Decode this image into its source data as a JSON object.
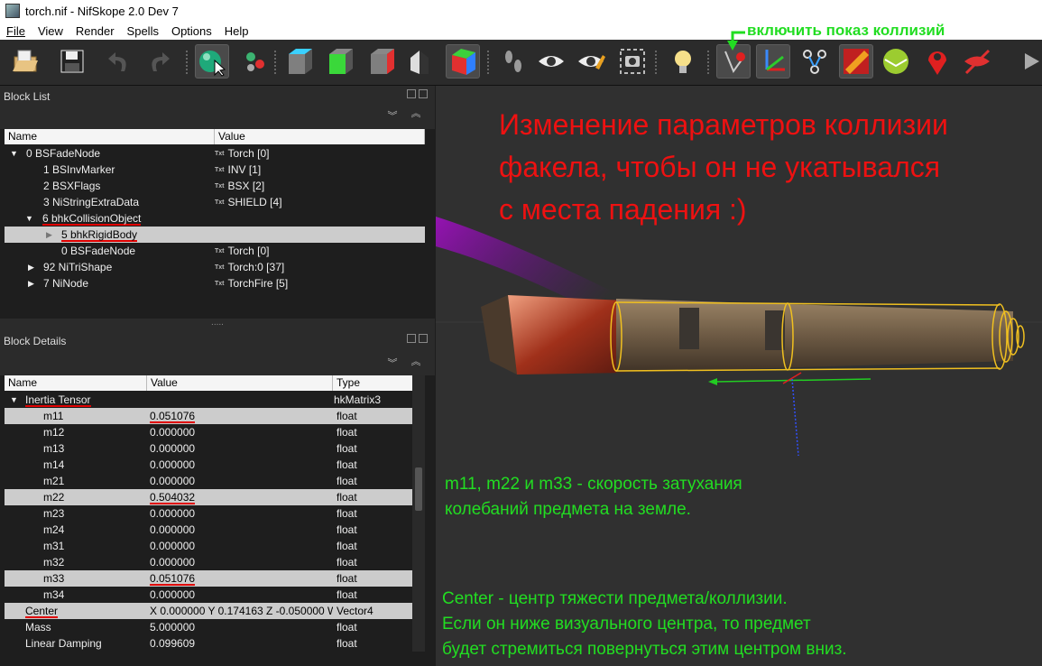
{
  "window": {
    "title": "torch.nif - NifSkope 2.0 Dev 7"
  },
  "menu": [
    "File",
    "View",
    "Render",
    "Spells",
    "Options",
    "Help"
  ],
  "toolbar_icons": [
    "open-icon",
    "save-icon",
    "undo-icon",
    "redo-icon",
    "select-icon",
    "transform-icon",
    "view-top-icon",
    "view-front-icon",
    "view-side-icon",
    "view-user-icon",
    "view-perspective-icon",
    "walk-icon",
    "eye-icon",
    "eye-dropper-icon",
    "screenshot-icon",
    "light-icon",
    "collision-toggle-icon",
    "axes-icon",
    "nodes-icon",
    "texture-icon",
    "sphere-icon",
    "marker-icon",
    "hide-icon",
    "play-icon"
  ],
  "block_list": {
    "title": "Block List",
    "columns": [
      "Name",
      "Value"
    ],
    "rows": [
      {
        "name": "0 BSFadeNode",
        "value": "Torch [0]"
      },
      {
        "name": "1 BSInvMarker",
        "value": "INV [1]"
      },
      {
        "name": "2 BSXFlags",
        "value": "BSX [2]"
      },
      {
        "name": "3 NiStringExtraData",
        "value": "SHIELD [4]"
      },
      {
        "name": "6 bhkCollisionObject",
        "value": ""
      },
      {
        "name": "5 bhkRigidBody",
        "value": ""
      },
      {
        "name": "0 BSFadeNode",
        "value": "Torch [0]"
      },
      {
        "name": "92 NiTriShape",
        "value": "Torch:0 [37]"
      },
      {
        "name": "7 NiNode",
        "value": "TorchFire [5]"
      }
    ],
    "txt_badge": "Txt",
    "splitter": "....."
  },
  "block_details": {
    "title": "Block Details",
    "columns": [
      "Name",
      "Value",
      "Type"
    ],
    "rows": [
      {
        "name": "Inertia Tensor",
        "value": "",
        "type": "hkMatrix3"
      },
      {
        "name": "m11",
        "value": "0.051076",
        "type": "float"
      },
      {
        "name": "m12",
        "value": "0.000000",
        "type": "float"
      },
      {
        "name": "m13",
        "value": "0.000000",
        "type": "float"
      },
      {
        "name": "m14",
        "value": "0.000000",
        "type": "float"
      },
      {
        "name": "m21",
        "value": "0.000000",
        "type": "float"
      },
      {
        "name": "m22",
        "value": "0.504032",
        "type": "float"
      },
      {
        "name": "m23",
        "value": "0.000000",
        "type": "float"
      },
      {
        "name": "m24",
        "value": "0.000000",
        "type": "float"
      },
      {
        "name": "m31",
        "value": "0.000000",
        "type": "float"
      },
      {
        "name": "m32",
        "value": "0.000000",
        "type": "float"
      },
      {
        "name": "m33",
        "value": "0.051076",
        "type": "float"
      },
      {
        "name": "m34",
        "value": "0.000000",
        "type": "float"
      },
      {
        "name": "Center",
        "value": "X 0.000000 Y 0.174163 Z -0.050000 W...",
        "type": "Vector4"
      },
      {
        "name": "Mass",
        "value": "5.000000",
        "type": "float"
      },
      {
        "name": "Linear Damping",
        "value": "0.099609",
        "type": "float"
      }
    ]
  },
  "annotations": {
    "collision_toggle": "включить показ коллизий",
    "heading_line1": "Изменение параметров коллизии",
    "heading_line2": "факела, чтобы он не укатывался",
    "heading_line3": "с места падения :)",
    "damping_line1": "m11, m22 и m33 - скорость затухания",
    "damping_line2": "колебаний предмета на земле.",
    "center_line1": "Center - центр тяжести предмета/коллизии.",
    "center_line2": "Если он ниже визуального центра, то предмет",
    "center_line3": "будет стремиться повернуться этим центром вниз."
  },
  "colors": {
    "annotation_red": "#ee1111",
    "annotation_green": "#22dd22",
    "selection": "#cccccc",
    "underline": "#e00000"
  }
}
